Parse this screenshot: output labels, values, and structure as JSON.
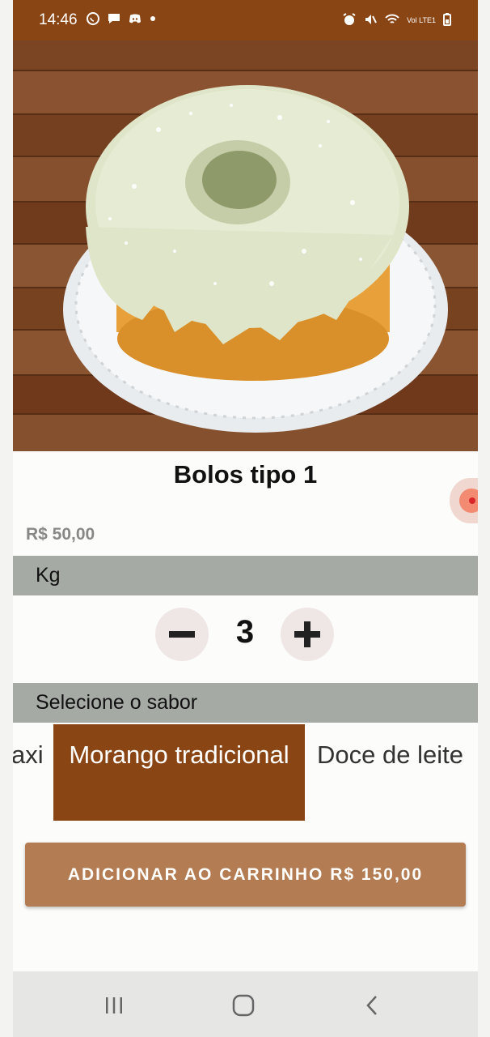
{
  "status_bar": {
    "time": "14:46",
    "left_icons": [
      "whatsapp-icon",
      "message-icon",
      "discord-icon",
      "dot-icon"
    ],
    "right_icons": [
      "alarm-icon",
      "mute-icon",
      "wifi-icon",
      "signal-icon",
      "battery-icon"
    ],
    "carrier_text": "Vol LTE1"
  },
  "product": {
    "image_alt": "bolo com cobertura de coco",
    "title": "Bolos tipo 1",
    "price": "R$ 50,00"
  },
  "unit_section": {
    "label": "Kg"
  },
  "stepper": {
    "minus": "−",
    "value": "3",
    "plus": "+"
  },
  "flavor_section": {
    "label": "Selecione o sabor",
    "options": [
      {
        "label": "axi",
        "selected": false
      },
      {
        "label": "Morango tradicional",
        "selected": true
      },
      {
        "label": "Doce de leite",
        "selected": false
      }
    ]
  },
  "cart_button": {
    "label": "ADICIONAR AO CARRINHO R$ 150,00"
  },
  "nav_bar": {
    "recent": "|||",
    "home": "○",
    "back": "<"
  },
  "colors": {
    "brand_brown": "#8a4515",
    "button_brown": "#b47c52",
    "section_gray": "#a6aaa5"
  }
}
